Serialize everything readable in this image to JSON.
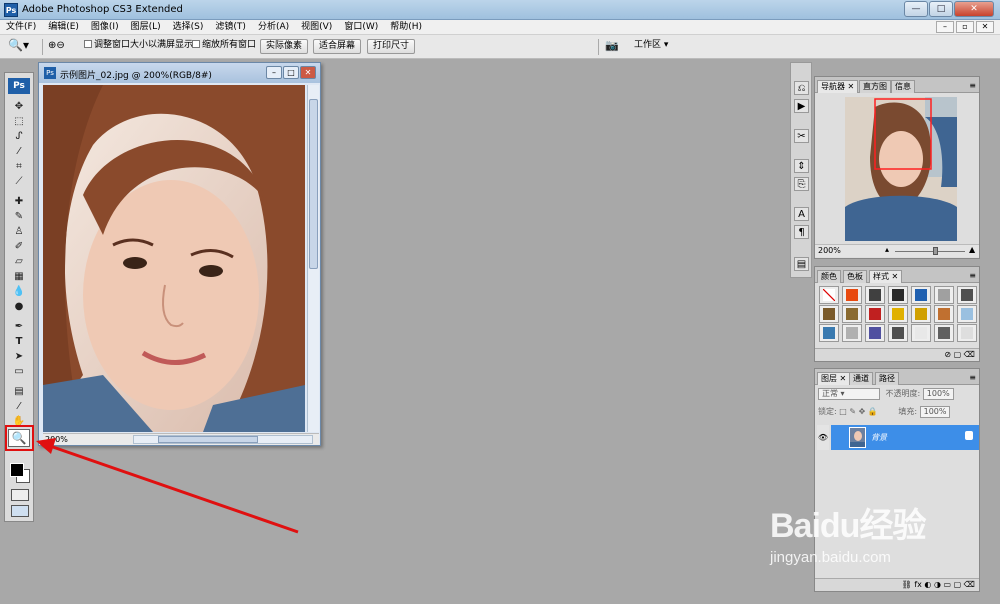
{
  "app": {
    "title": "Adobe Photoshop CS3 Extended",
    "logo": "Ps",
    "window_buttons": {
      "minimize": "—",
      "maximize": "□",
      "close": "✕"
    }
  },
  "menu": [
    "文件(F)",
    "编辑(E)",
    "图像(I)",
    "图层(L)",
    "选择(S)",
    "滤镜(T)",
    "分析(A)",
    "视图(V)",
    "窗口(W)",
    "帮助(H)"
  ],
  "options": {
    "resize_windows": "调整窗口大小以满屏显示",
    "zoom_all": "缩放所有窗口",
    "actual_pixels": "实际像素",
    "fit_screen": "适合屏幕",
    "print_size": "打印尺寸",
    "workspace": "工作区 ▾"
  },
  "toolbox": {
    "logo": "Ps",
    "active_tool": "zoom-tool"
  },
  "document": {
    "title": "示例图片_02.jpg @ 200%(RGB/8#)",
    "zoom": "200%",
    "icon": "Ps"
  },
  "navigator": {
    "tabs": [
      "导航器",
      "直方图",
      "信息"
    ],
    "zoom": "200%"
  },
  "styles_panel": {
    "tabs": [
      "颜色",
      "色板",
      "样式"
    ],
    "swatch_colors": [
      "#ffffff",
      "#e84a10",
      "#404040",
      "#2a2a2a",
      "#2060b0",
      "#a0a0a0",
      "#505050",
      "#7a5a2a",
      "#8a6a30",
      "#c02020",
      "#e0b000",
      "#d0a000",
      "#c07030",
      "#9ac0e0",
      "#3a7ab0",
      "#b0b0b0",
      "#5050a0",
      "#505050",
      "#e8e8e8",
      "#606060",
      "#dedede"
    ]
  },
  "layers_panel": {
    "tabs": [
      "图层",
      "通道",
      "路径"
    ],
    "blend_mode": "正常",
    "opacity_label": "不透明度:",
    "opacity": "100%",
    "lock_label": "锁定:",
    "fill_label": "填充:",
    "fill": "100%",
    "layer_name": "背景"
  },
  "watermark": {
    "brand": "Baidu经验",
    "url": "jingyan.baidu.com"
  },
  "annotation": {
    "highlight_color": "#e01010"
  }
}
